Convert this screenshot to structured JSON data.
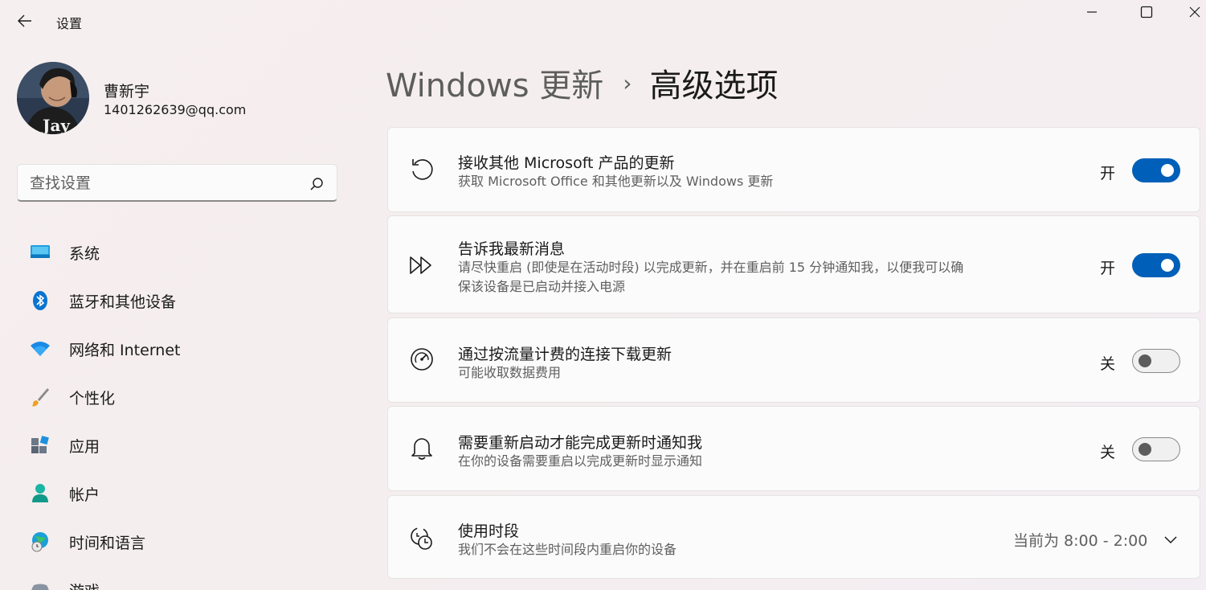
{
  "window": {
    "title": "设置"
  },
  "user": {
    "name": "曹新宇",
    "email": "1401262639@qq.com",
    "avatar_text": "Jay"
  },
  "search": {
    "placeholder": "查找设置"
  },
  "nav": [
    {
      "label": "系统",
      "icon": "monitor-icon"
    },
    {
      "label": "蓝牙和其他设备",
      "icon": "bluetooth-icon"
    },
    {
      "label": "网络和 Internet",
      "icon": "wifi-icon"
    },
    {
      "label": "个性化",
      "icon": "brush-icon"
    },
    {
      "label": "应用",
      "icon": "apps-icon"
    },
    {
      "label": "帐户",
      "icon": "account-icon"
    },
    {
      "label": "时间和语言",
      "icon": "globe-clock-icon"
    },
    {
      "label": "游戏",
      "icon": "gamepad-icon"
    }
  ],
  "header": {
    "parent": "Windows 更新",
    "separator": "›",
    "current": "高级选项"
  },
  "settings": [
    {
      "title": "接收其他 Microsoft 产品的更新",
      "description": "获取 Microsoft Office 和其他更新以及 Windows 更新",
      "state_label": "开",
      "on": true,
      "icon": "refresh-icon"
    },
    {
      "title": "告诉我最新消息",
      "description": "请尽快重启 (即使是在活动时段) 以完成更新，并在重启前 15 分钟通知我，以便我可以确保该设备是已启动并接入电源",
      "state_label": "开",
      "on": true,
      "icon": "fast-forward-icon"
    },
    {
      "title": "通过按流量计费的连接下载更新",
      "description": "可能收取数据费用",
      "state_label": "关",
      "on": false,
      "icon": "speedometer-icon"
    },
    {
      "title": "需要重新启动才能完成更新时通知我",
      "description": "在你的设备需要重启以完成更新时显示通知",
      "state_label": "关",
      "on": false,
      "icon": "bell-icon"
    }
  ],
  "active_hours": {
    "title": "使用时段",
    "description": "我们不会在这些时间段内重启你的设备",
    "value": "当前为 8:00 - 2:00",
    "icon": "clock-schedule-icon"
  },
  "colors": {
    "accent": "#005fb8",
    "background": "#f6efef",
    "card": "#fbfbfb"
  }
}
